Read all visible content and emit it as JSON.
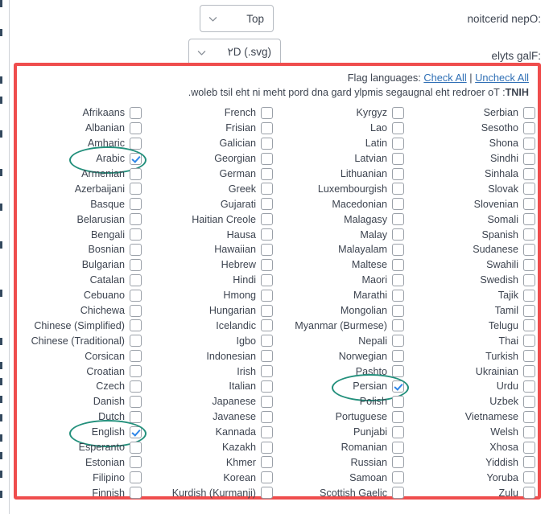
{
  "settings": [
    {
      "label": ":Open direction",
      "value": "Top",
      "name": "open-direction"
    },
    {
      "label": ":Flag style",
      "value": "۲D (.svg)",
      "name": "flag-style"
    }
  ],
  "panel": {
    "flag_languages_label": "Flag languages:",
    "check_all": "Check All",
    "separator": "|",
    "uncheck_all": "Uncheck All",
    "hint_prefix": "HINT",
    "hint_text": ": To reorder the languages simply drag and drop them in the list below.",
    "accent_red": "#ef4d4d",
    "accent_teal": "#23907c",
    "accent_blue_check": "#2f86e8",
    "link_color": "#2f6fb5"
  },
  "columns": [
    {
      "items": [
        {
          "label": "Afrikaans",
          "checked": false
        },
        {
          "label": "Albanian",
          "checked": false
        },
        {
          "label": "Amharic",
          "checked": false
        },
        {
          "label": "Arabic",
          "checked": true,
          "annotated": true
        },
        {
          "label": "Armenian",
          "checked": false
        },
        {
          "label": "Azerbaijani",
          "checked": false
        },
        {
          "label": "Basque",
          "checked": false
        },
        {
          "label": "Belarusian",
          "checked": false
        },
        {
          "label": "Bengali",
          "checked": false
        },
        {
          "label": "Bosnian",
          "checked": false
        },
        {
          "label": "Bulgarian",
          "checked": false
        },
        {
          "label": "Catalan",
          "checked": false
        },
        {
          "label": "Cebuano",
          "checked": false
        },
        {
          "label": "Chichewa",
          "checked": false
        },
        {
          "label": "Chinese (Simplified)",
          "checked": false
        },
        {
          "label": "Chinese (Traditional)",
          "checked": false
        },
        {
          "label": "Corsican",
          "checked": false
        },
        {
          "label": "Croatian",
          "checked": false
        },
        {
          "label": "Czech",
          "checked": false
        },
        {
          "label": "Danish",
          "checked": false
        },
        {
          "label": "Dutch",
          "checked": false
        },
        {
          "label": "English",
          "checked": true,
          "annotated": true
        },
        {
          "label": "Esperanto",
          "checked": false
        },
        {
          "label": "Estonian",
          "checked": false
        },
        {
          "label": "Filipino",
          "checked": false
        },
        {
          "label": "Finnish",
          "checked": false
        }
      ]
    },
    {
      "items": [
        {
          "label": "French",
          "checked": false
        },
        {
          "label": "Frisian",
          "checked": false
        },
        {
          "label": "Galician",
          "checked": false
        },
        {
          "label": "Georgian",
          "checked": false
        },
        {
          "label": "German",
          "checked": false
        },
        {
          "label": "Greek",
          "checked": false
        },
        {
          "label": "Gujarati",
          "checked": false
        },
        {
          "label": "Haitian Creole",
          "checked": false
        },
        {
          "label": "Hausa",
          "checked": false
        },
        {
          "label": "Hawaiian",
          "checked": false
        },
        {
          "label": "Hebrew",
          "checked": false
        },
        {
          "label": "Hindi",
          "checked": false
        },
        {
          "label": "Hmong",
          "checked": false
        },
        {
          "label": "Hungarian",
          "checked": false
        },
        {
          "label": "Icelandic",
          "checked": false
        },
        {
          "label": "Igbo",
          "checked": false
        },
        {
          "label": "Indonesian",
          "checked": false
        },
        {
          "label": "Irish",
          "checked": false
        },
        {
          "label": "Italian",
          "checked": false
        },
        {
          "label": "Japanese",
          "checked": false
        },
        {
          "label": "Javanese",
          "checked": false
        },
        {
          "label": "Kannada",
          "checked": false
        },
        {
          "label": "Kazakh",
          "checked": false
        },
        {
          "label": "Khmer",
          "checked": false
        },
        {
          "label": "Korean",
          "checked": false
        },
        {
          "label": "Kurdish (Kurmanji)",
          "checked": false
        }
      ]
    },
    {
      "items": [
        {
          "label": "Kyrgyz",
          "checked": false
        },
        {
          "label": "Lao",
          "checked": false
        },
        {
          "label": "Latin",
          "checked": false
        },
        {
          "label": "Latvian",
          "checked": false
        },
        {
          "label": "Lithuanian",
          "checked": false
        },
        {
          "label": "Luxembourgish",
          "checked": false
        },
        {
          "label": "Macedonian",
          "checked": false
        },
        {
          "label": "Malagasy",
          "checked": false
        },
        {
          "label": "Malay",
          "checked": false
        },
        {
          "label": "Malayalam",
          "checked": false
        },
        {
          "label": "Maltese",
          "checked": false
        },
        {
          "label": "Maori",
          "checked": false
        },
        {
          "label": "Marathi",
          "checked": false
        },
        {
          "label": "Mongolian",
          "checked": false
        },
        {
          "label": "Myanmar (Burmese)",
          "checked": false
        },
        {
          "label": "Nepali",
          "checked": false
        },
        {
          "label": "Norwegian",
          "checked": false
        },
        {
          "label": "Pashto",
          "checked": false
        },
        {
          "label": "Persian",
          "checked": true,
          "annotated": true
        },
        {
          "label": "Polish",
          "checked": false
        },
        {
          "label": "Portuguese",
          "checked": false
        },
        {
          "label": "Punjabi",
          "checked": false
        },
        {
          "label": "Romanian",
          "checked": false
        },
        {
          "label": "Russian",
          "checked": false
        },
        {
          "label": "Samoan",
          "checked": false
        },
        {
          "label": "Scottish Gaelic",
          "checked": false
        }
      ]
    },
    {
      "items": [
        {
          "label": "Serbian",
          "checked": false
        },
        {
          "label": "Sesotho",
          "checked": false
        },
        {
          "label": "Shona",
          "checked": false
        },
        {
          "label": "Sindhi",
          "checked": false
        },
        {
          "label": "Sinhala",
          "checked": false
        },
        {
          "label": "Slovak",
          "checked": false
        },
        {
          "label": "Slovenian",
          "checked": false
        },
        {
          "label": "Somali",
          "checked": false
        },
        {
          "label": "Spanish",
          "checked": false
        },
        {
          "label": "Sudanese",
          "checked": false
        },
        {
          "label": "Swahili",
          "checked": false
        },
        {
          "label": "Swedish",
          "checked": false
        },
        {
          "label": "Tajik",
          "checked": false
        },
        {
          "label": "Tamil",
          "checked": false
        },
        {
          "label": "Telugu",
          "checked": false
        },
        {
          "label": "Thai",
          "checked": false
        },
        {
          "label": "Turkish",
          "checked": false
        },
        {
          "label": "Ukrainian",
          "checked": false
        },
        {
          "label": "Urdu",
          "checked": false
        },
        {
          "label": "Uzbek",
          "checked": false
        },
        {
          "label": "Vietnamese",
          "checked": false
        },
        {
          "label": "Welsh",
          "checked": false
        },
        {
          "label": "Xhosa",
          "checked": false
        },
        {
          "label": "Yiddish",
          "checked": false
        },
        {
          "label": "Yoruba",
          "checked": false
        },
        {
          "label": "Zulu",
          "checked": false
        }
      ]
    }
  ]
}
